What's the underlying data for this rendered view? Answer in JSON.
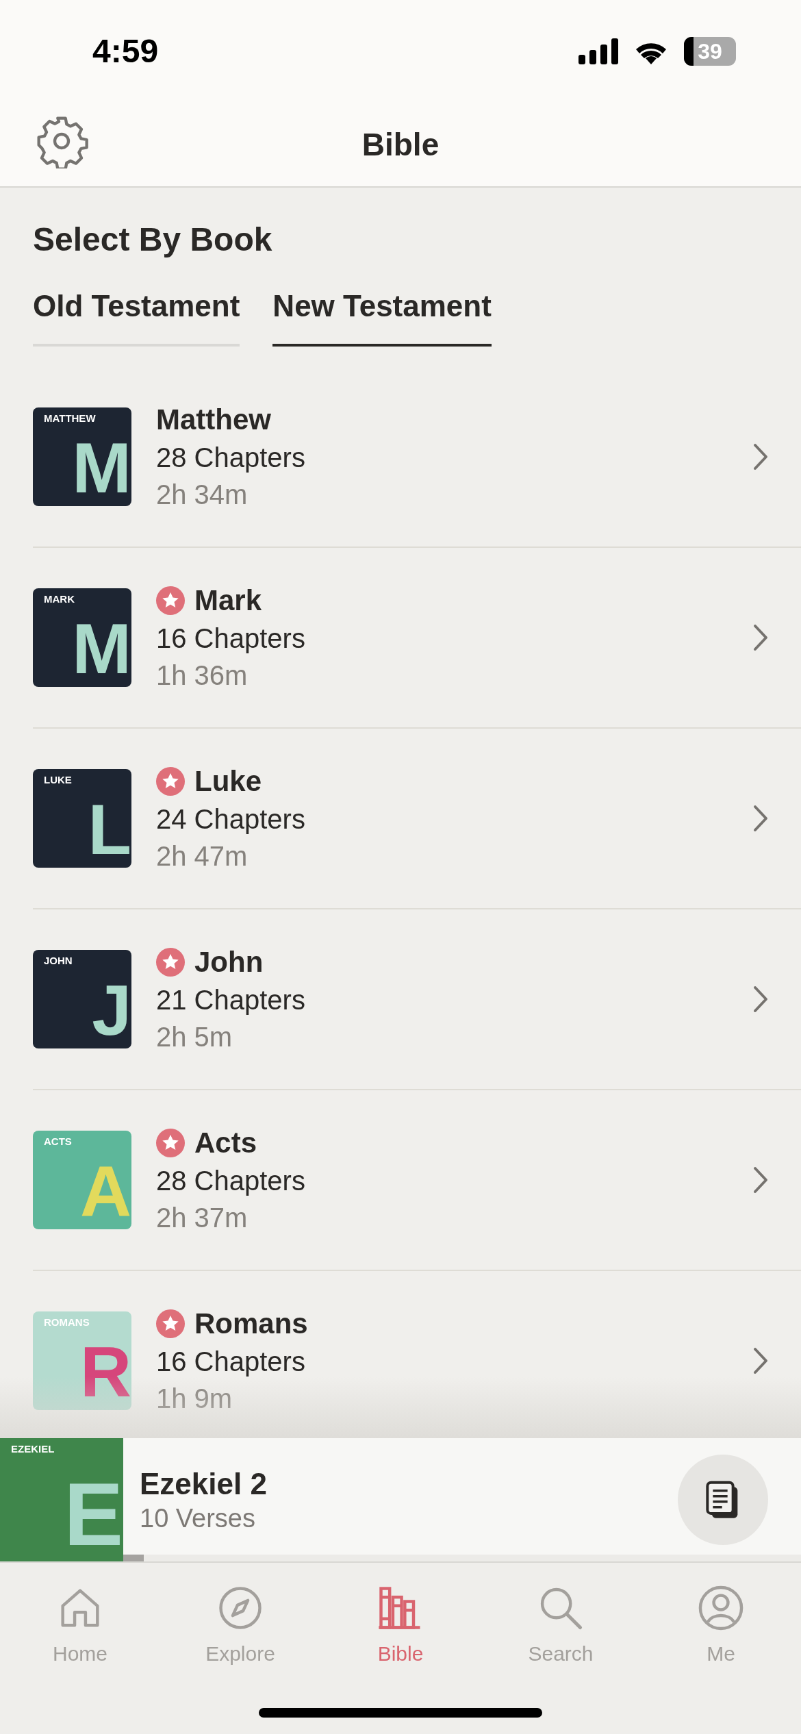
{
  "status_bar": {
    "time": "4:59",
    "battery": "39"
  },
  "nav": {
    "title": "Bible"
  },
  "section_title": "Select By Book",
  "tabs": [
    {
      "label": "Old Testament",
      "selected": false
    },
    {
      "label": "New Testament",
      "selected": true
    }
  ],
  "books": [
    {
      "name": "Matthew",
      "chapters": "28 Chapters",
      "duration": "2h 34m",
      "starred": false,
      "cover": {
        "kind": "dark",
        "title": "MATTHEW",
        "letter": "M"
      }
    },
    {
      "name": "Mark",
      "chapters": "16 Chapters",
      "duration": "1h 36m",
      "starred": true,
      "cover": {
        "kind": "dark",
        "title": "MARK",
        "letter": "M"
      }
    },
    {
      "name": "Luke",
      "chapters": "24 Chapters",
      "duration": "2h 47m",
      "starred": true,
      "cover": {
        "kind": "dark",
        "title": "LUKE",
        "letter": "L"
      }
    },
    {
      "name": "John",
      "chapters": "21 Chapters",
      "duration": "2h 5m",
      "starred": true,
      "cover": {
        "kind": "dark",
        "title": "JOHN",
        "letter": "J"
      }
    },
    {
      "name": "Acts",
      "chapters": "28 Chapters",
      "duration": "2h 37m",
      "starred": true,
      "cover": {
        "kind": "teal",
        "title": "ACTS",
        "letter": "A"
      }
    },
    {
      "name": "Romans",
      "chapters": "16 Chapters",
      "duration": "1h 9m",
      "starred": true,
      "cover": {
        "kind": "mint",
        "title": "ROMANS",
        "letter": "R"
      }
    }
  ],
  "now_playing": {
    "title": "Ezekiel 2",
    "subtitle": "10 Verses",
    "level": 0.03,
    "cover": {
      "kind": "green",
      "title": "EZEKIEL",
      "letter": "E"
    }
  },
  "tab_bar": [
    {
      "label": "Home",
      "kind": "home",
      "selected": false
    },
    {
      "label": "Explore",
      "kind": "compass",
      "selected": false
    },
    {
      "label": "Bible",
      "kind": "books",
      "selected": true
    },
    {
      "label": "Search",
      "kind": "search",
      "selected": false
    },
    {
      "label": "Me",
      "kind": "person",
      "selected": false
    }
  ]
}
